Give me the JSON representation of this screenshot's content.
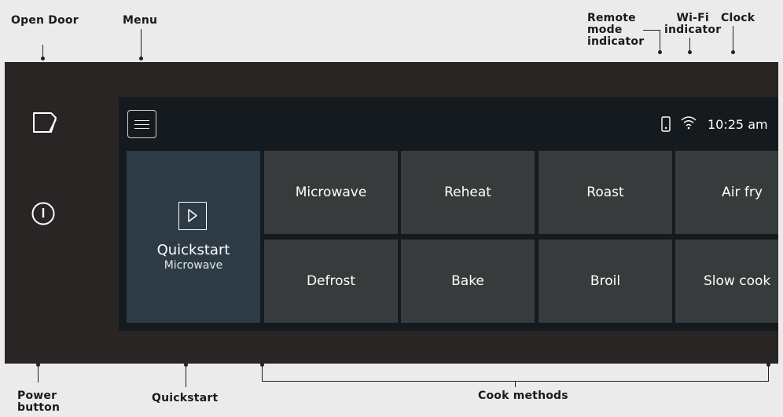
{
  "callouts": {
    "open_door": "Open Door",
    "menu": "Menu",
    "remote_mode": [
      "Remote",
      "mode",
      "indicator"
    ],
    "wifi": [
      "Wi-Fi",
      "indicator"
    ],
    "clock": "Clock",
    "power_button": [
      "Power",
      "button"
    ],
    "quickstart": "Quickstart",
    "cook_methods": "Cook methods"
  },
  "screen": {
    "time": "10:25 am",
    "quickstart": {
      "title": "Quickstart",
      "subtitle": "Microwave"
    },
    "cook_methods_row1": [
      "Microwave",
      "Reheat",
      "Roast",
      "Air fry"
    ],
    "cook_methods_row2": [
      "Defrost",
      "Bake",
      "Broil",
      "Slow cook"
    ]
  },
  "icons": {
    "open_door": "open-door-icon",
    "power": "power-icon",
    "menu": "hamburger-menu-icon",
    "remote": "phone-icon",
    "wifi": "wifi-icon",
    "play": "play-icon"
  },
  "colors": {
    "background": "#ebebeb",
    "panel": "#282524",
    "screen": "#151a1e",
    "quickstart_tile": "#2c3b45",
    "cook_tile": "#383b3b"
  }
}
